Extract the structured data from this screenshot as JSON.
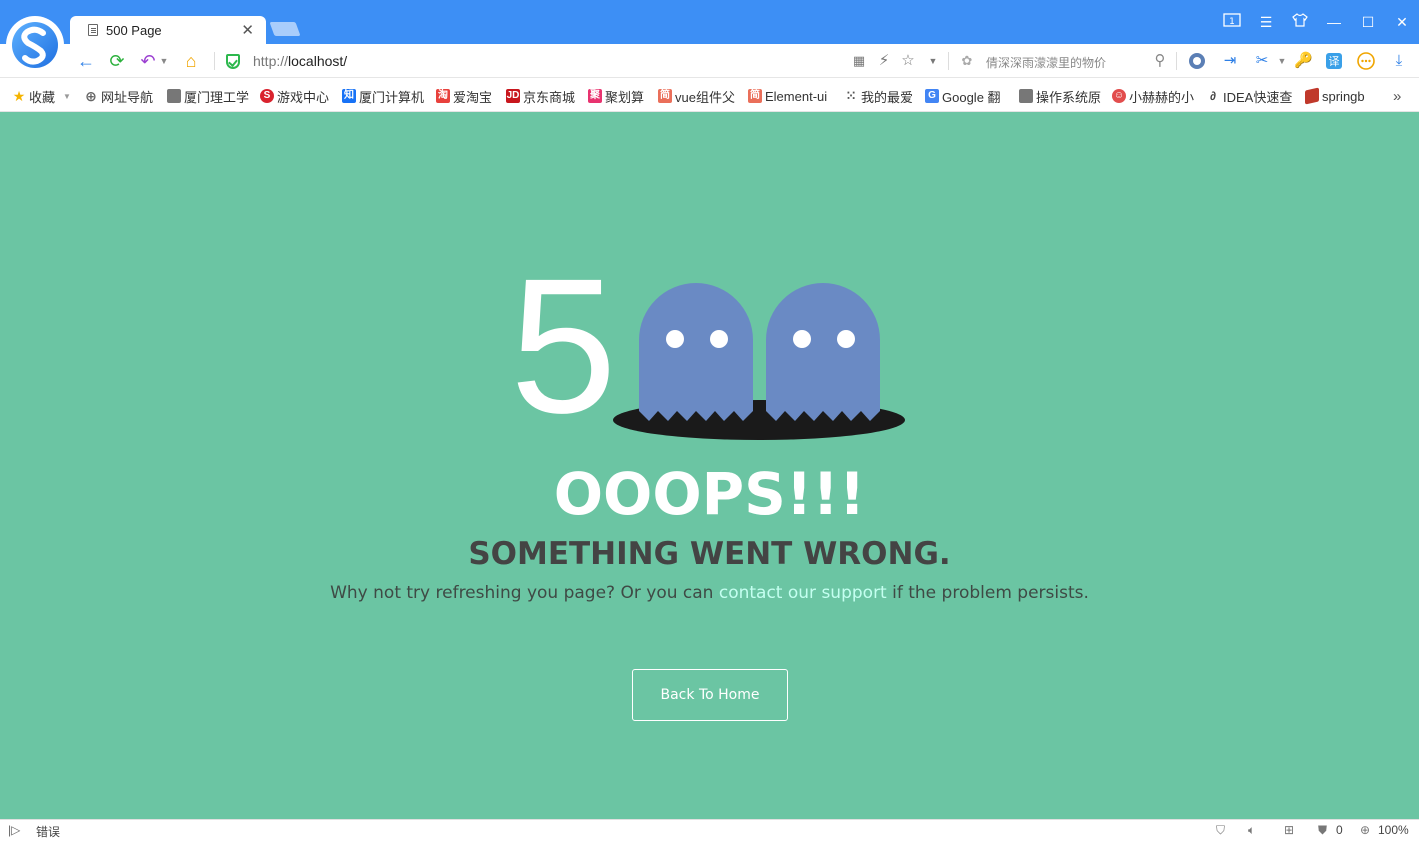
{
  "browser": {
    "tab_title": "500 Page",
    "url_prefix": "http://",
    "url_host": "localhost/",
    "search_placeholder": "倩深深雨濛濛里的物价",
    "status_text": "错误",
    "zoom": "100%",
    "ad_count": "0",
    "brand_color": "#3d8ff5"
  },
  "bookmarks": [
    {
      "label": "收藏",
      "icon": "star-icon"
    },
    {
      "label": "网址导航",
      "icon": "globe-icon"
    },
    {
      "label": "厦门理工学",
      "icon": "doc-icon"
    },
    {
      "label": "游戏中心",
      "icon": "game-icon"
    },
    {
      "label": "厦门计算机",
      "icon": "zhihu-icon"
    },
    {
      "label": "爱淘宝",
      "icon": "taobao-icon"
    },
    {
      "label": "京东商城",
      "icon": "jd-icon"
    },
    {
      "label": "聚划算",
      "icon": "juhuasuan-icon"
    },
    {
      "label": "vue组件父",
      "icon": "jianshu-icon"
    },
    {
      "label": "Element-ui",
      "icon": "jianshu-icon"
    },
    {
      "label": "我的最爱",
      "icon": "apps-icon"
    },
    {
      "label": "Google 翻",
      "icon": "google-translate-icon"
    },
    {
      "label": "操作系统原",
      "icon": "doc-icon"
    },
    {
      "label": "小赫赫的小",
      "icon": "avatar-icon"
    },
    {
      "label": "IDEA快速查",
      "icon": "idea-icon"
    },
    {
      "label": "springb",
      "icon": "scala-icon"
    }
  ],
  "error_page": {
    "code_digit": "5",
    "headline": "OOOPS!!!",
    "subheadline": "SOMETHING WENT WRONG.",
    "message_before": "Why not try refreshing you page? Or you can ",
    "message_link": "contact our support",
    "message_after": " if the problem persists.",
    "button_label": "Back To Home",
    "background_color": "#6bc5a3",
    "ghost_color": "#6a8ac4"
  }
}
